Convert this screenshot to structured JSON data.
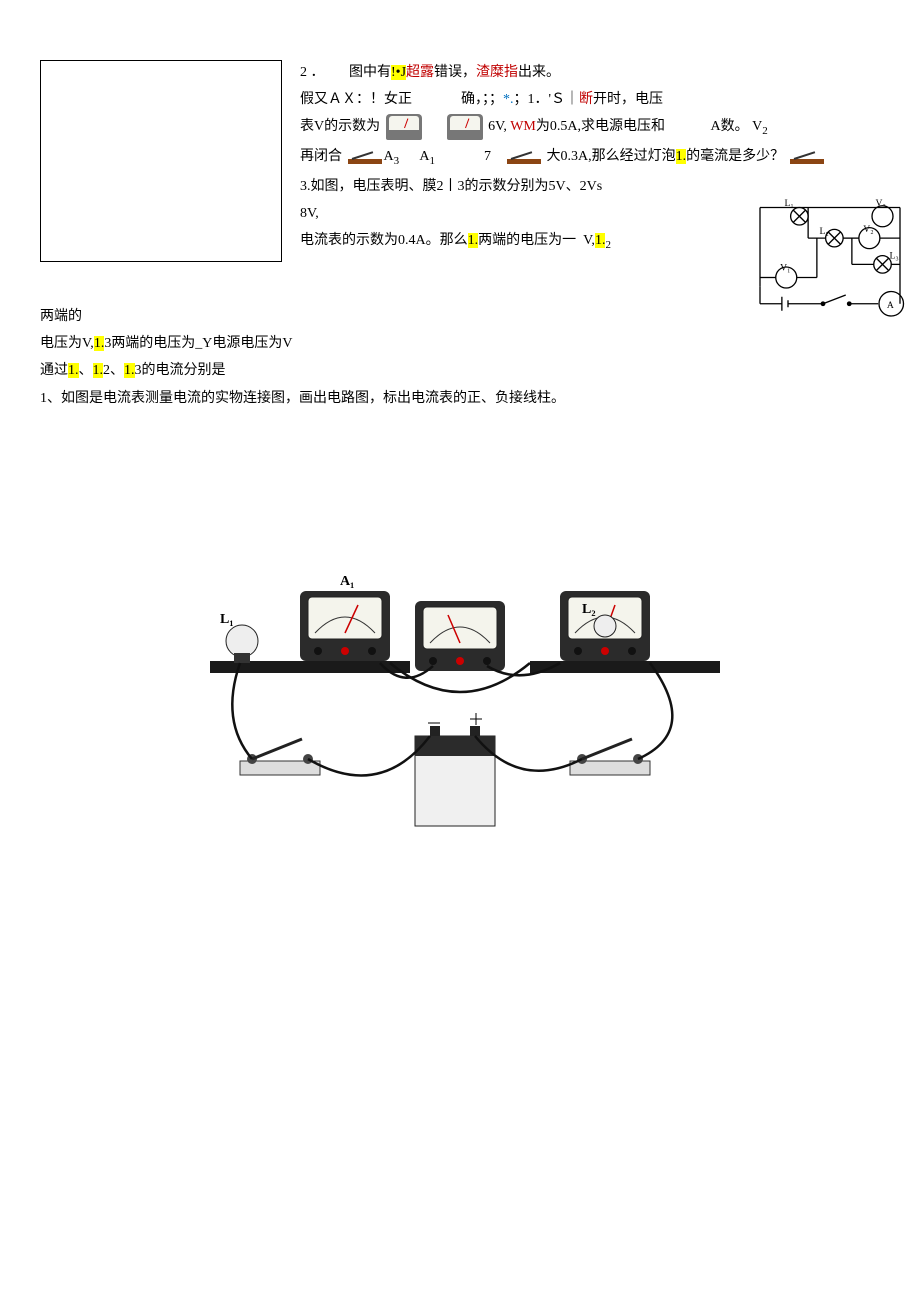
{
  "q2": {
    "intro_a": "2 ．",
    "intro_b": "图中有",
    "intro_hl": "!•J",
    "intro_c_red": "超露",
    "intro_d": "错误，",
    "intro_e_red": "渣糜指",
    "intro_f": "出来。",
    "line2_a": "假又ＡＸ：！女正",
    "line2_b": "确，；；",
    "line2_c_blue": "*.",
    "line2_d": "；1．'Ｓ｜",
    "line2_e_red": "断",
    "line2_f": "开时，电压",
    "line3_a": "表V的示数为",
    "line3_b": "6V, ",
    "line3_c_red": "WM",
    "line3_d": "为0.5A,求电源电压和",
    "line3_e": "А数。",
    "line3_v2": "V",
    "line3_v2sub": "2",
    "line4_a": "再闭合",
    "a3": "A",
    "a3sub": "3",
    "a1": "A",
    "a1sub": "1",
    "line4_b": "7",
    "line4_c": "大0.3A,那么经过灯泡",
    "line4_hl": "1.",
    "line4_d": "的毫流是多少？"
  },
  "q3": {
    "line1": "3.如图，电压表明、膜2丨3的示数分别为5V、2Vs",
    "line2": "8V,",
    "line3a": "电流表的示数为0.4A。那么",
    "line3hl": "1.",
    "line3b": "两端的电压为一",
    "line3c": "V,",
    "line3d": "1.",
    "line3sub": "2",
    "after1": "两端的",
    "after2a": "电压为V,",
    "after2hl": "1.",
    "after2b": "3两端的电压为_Y电源电压为V",
    "after3a": "通过",
    "after3hl1": "1.",
    "after3b": "、",
    "after3hl2": "1.",
    "after3c": "2、",
    "after3hl3": "1.",
    "after3d": "3的电流分别是"
  },
  "q1": {
    "text": "1、如图是电流表测量电流的实物连接图，画出电路图，标出电流表的正、负接线柱。"
  },
  "circuit_labels": {
    "L1": "L₁",
    "L2": "L₂",
    "L3": "L₃",
    "V1": "V₁",
    "V2": "V₂",
    "V3": "V₃",
    "A": "A"
  },
  "lower": {
    "A1": "A₁",
    "L1": "L₁",
    "L2": "L₂"
  }
}
